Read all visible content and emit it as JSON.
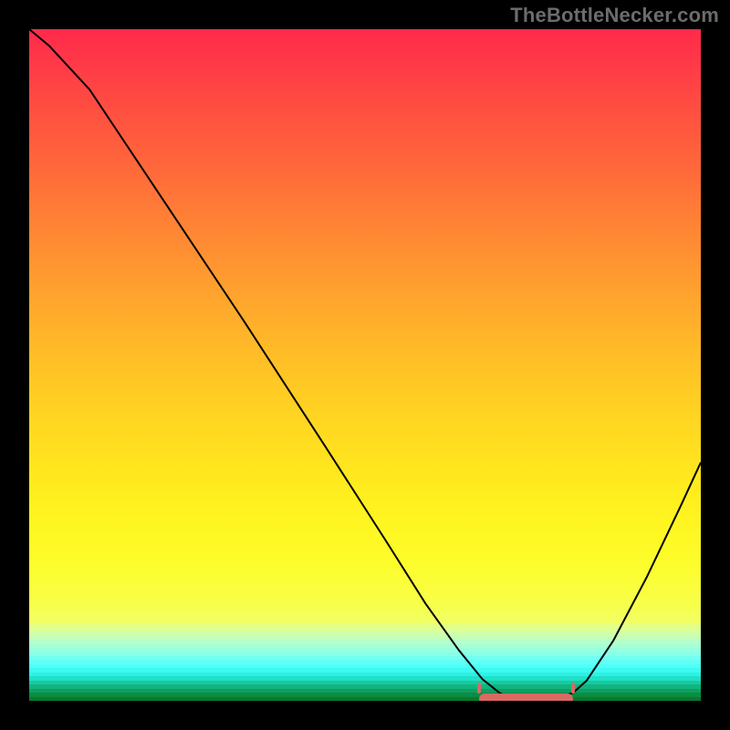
{
  "watermark": "TheBottleNecker.com",
  "colors": {
    "frame": "#000000",
    "curve": "#000000",
    "highlight": "#d86a64",
    "gradient_stops": [
      "#ff2a4a",
      "#ff3a48",
      "#ff5040",
      "#ff6a3a",
      "#ff8634",
      "#ffa12e",
      "#ffbb28",
      "#ffd222",
      "#ffe61e",
      "#fff41f",
      "#fdfd2c",
      "#f7ff4a",
      "#f1ff68"
    ],
    "bottom_bands": [
      "#e6ff82",
      "#dcff95",
      "#d0ffa8",
      "#c3ffb9",
      "#b5ffc8",
      "#a6ffd5",
      "#97ffe0",
      "#86ffe9",
      "#74fff0",
      "#61fff5",
      "#4efff6",
      "#3cfaf2",
      "#2ef0e4",
      "#20e0c6",
      "#16caa1",
      "#11b47e",
      "#0e9f5e",
      "#0b8c43",
      "#087a2d"
    ]
  },
  "chart_data": {
    "type": "line",
    "title": "",
    "xlabel": "",
    "ylabel": "",
    "xlim": [
      0,
      100
    ],
    "ylim": [
      0,
      100
    ],
    "grid": false,
    "curve": [
      {
        "x": 0,
        "y": 100
      },
      {
        "x": 3,
        "y": 97.5
      },
      {
        "x": 9,
        "y": 91
      },
      {
        "x": 20,
        "y": 74.5
      },
      {
        "x": 32,
        "y": 56.5
      },
      {
        "x": 44,
        "y": 38
      },
      {
        "x": 53,
        "y": 24
      },
      {
        "x": 59,
        "y": 14.5
      },
      {
        "x": 64,
        "y": 7.5
      },
      {
        "x": 67.5,
        "y": 3.2
      },
      {
        "x": 70,
        "y": 1.2
      },
      {
        "x": 71.5,
        "y": 0.45
      },
      {
        "x": 75,
        "y": 0.2
      },
      {
        "x": 78.5,
        "y": 0.35
      },
      {
        "x": 81,
        "y": 1.2
      },
      {
        "x": 83,
        "y": 3
      },
      {
        "x": 87,
        "y": 9
      },
      {
        "x": 92,
        "y": 18.5
      },
      {
        "x": 97,
        "y": 29
      },
      {
        "x": 100,
        "y": 35.5
      }
    ],
    "highlight_band": {
      "x_start": 67,
      "x_end": 81,
      "y": 0.3
    }
  }
}
